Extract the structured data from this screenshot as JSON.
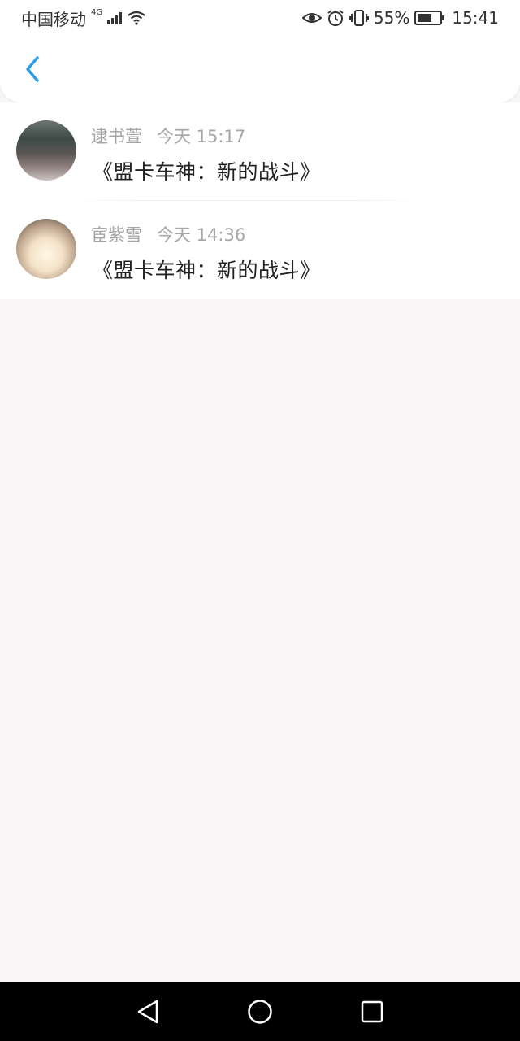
{
  "status_bar": {
    "carrier": "中国移动",
    "network": "4G",
    "battery_percent": "55%",
    "time": "15:41",
    "icons": [
      "signal-icon",
      "wifi-icon",
      "eye-icon",
      "alarm-icon",
      "vibrate-icon",
      "battery-icon"
    ]
  },
  "nav": {
    "back_icon": "chevron-left-icon",
    "accent_color": "#2c9de8"
  },
  "messages": [
    {
      "author": "逮书萱",
      "time": "今天 15:17",
      "title": "《盟卡车神：新的战斗》"
    },
    {
      "author": "宦紫雪",
      "time": "今天 14:36",
      "title": "《盟卡车神：新的战斗》"
    }
  ],
  "system_nav": {
    "icons": [
      "back-triangle-icon",
      "home-circle-icon",
      "recents-square-icon"
    ]
  }
}
